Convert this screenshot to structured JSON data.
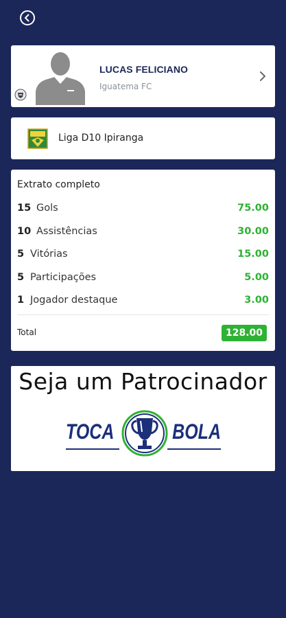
{
  "nav": {
    "back_icon": "back-arrow-circle-icon"
  },
  "player": {
    "name": "LUCAS FELICIANO",
    "club": "Iguatema FC",
    "avatar_icon": "person-silhouette-icon"
  },
  "league": {
    "name": "Liga D10 Ipiranga",
    "logo_icon": "league-crest-icon"
  },
  "statement": {
    "title": "Extrato completo",
    "rows": [
      {
        "count": "15",
        "label": "Gols",
        "value": "75.00"
      },
      {
        "count": "10",
        "label": "Assistências",
        "value": "30.00"
      },
      {
        "count": "5",
        "label": "Vitórias",
        "value": "15.00"
      },
      {
        "count": "5",
        "label": "Participações",
        "value": "5.00"
      },
      {
        "count": "1",
        "label": "Jogador destaque",
        "value": "3.00"
      }
    ],
    "total_label": "Total",
    "total_value": "128.00"
  },
  "sponsor": {
    "title": "Seja um Patrocinador",
    "brand_left": "TOCA",
    "brand_right": "BOLA"
  },
  "colors": {
    "background": "#1c2759",
    "accent_green": "#2eb233",
    "brand_blue": "#1c2f7a"
  }
}
